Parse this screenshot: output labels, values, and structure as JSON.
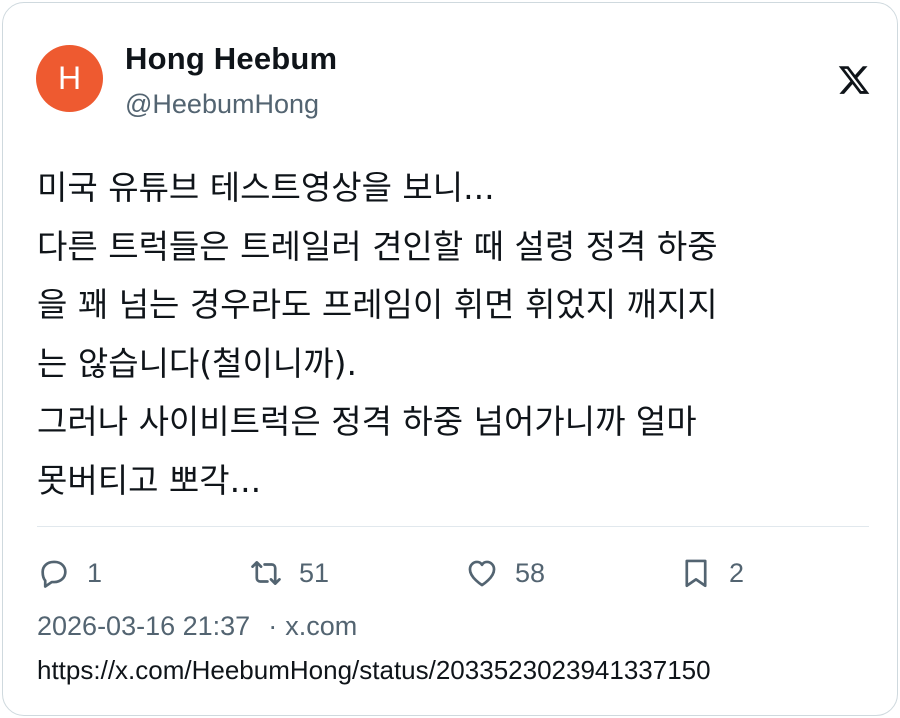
{
  "author": {
    "avatar_letter": "H",
    "avatar_color": "#ee5a30",
    "name": "Hong Heebum",
    "handle": "@HeebumHong"
  },
  "brand_icon": "x-logo-icon",
  "tweet": {
    "lines": [
      "미국 유튜브 테스트영상을 보니...",
      "다른 트럭들은 트레일러 견인할 때 설령 정격 하중",
      "을 꽤 넘는 경우라도 프레임이 휘면 휘었지 깨지지",
      "는 않습니다(철이니까).",
      "그러나 사이비트럭은 정격 하중 넘어가니까 얼마",
      "못버티고 뽀각..."
    ]
  },
  "actions": {
    "replies": {
      "icon": "reply-icon",
      "count": "1"
    },
    "reposts": {
      "icon": "repost-icon",
      "count": "51"
    },
    "likes": {
      "icon": "heart-icon",
      "count": "58"
    },
    "bookmarks": {
      "icon": "bookmark-icon",
      "count": "2"
    }
  },
  "meta": {
    "timestamp": "2026-03-16 21:37",
    "separator": "·",
    "source": "x.com"
  },
  "url": "https://x.com/HeebumHong/status/2033523023941337150",
  "colors": {
    "text": "#0f1419",
    "secondary": "#536471",
    "border": "#cfd9de"
  }
}
